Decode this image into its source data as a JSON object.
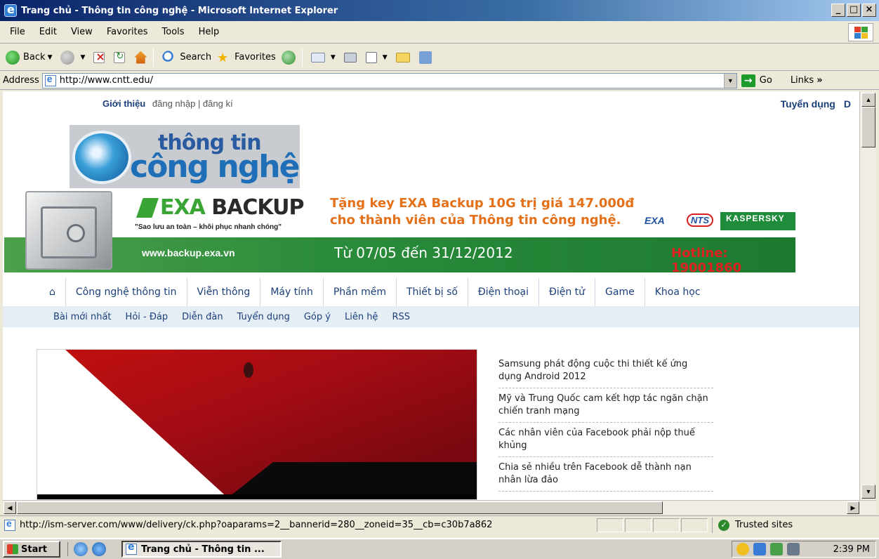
{
  "window": {
    "title": "Trang chủ - Thông tin công nghệ - Microsoft Internet Explorer",
    "min_label": "_",
    "max_label": "□",
    "close_label": "×"
  },
  "menubar": {
    "items": [
      "File",
      "Edit",
      "View",
      "Favorites",
      "Tools",
      "Help"
    ]
  },
  "toolbar": {
    "back_label": "Back",
    "search_label": "Search",
    "favorites_label": "Favorites"
  },
  "addressbar": {
    "label": "Address",
    "url": "http://www.cntt.edu/",
    "go_label": "Go",
    "links_label": "Links"
  },
  "site": {
    "top_links": {
      "intro": "Giới thiệu",
      "login": "đăng nhập | đăng kí"
    },
    "top_right": {
      "recruit": "Tuyển dụng",
      "cut": "D"
    },
    "logo": {
      "line1": "thông tin",
      "line2": "công nghệ"
    },
    "banner": {
      "brand_prefix": "EXA",
      "brand_suffix": " BACKUP",
      "slogan": "\"Sao lưu an toàn – khôi phục nhanh chóng\"",
      "promo_line1": "Tặng key EXA Backup 10G trị giá 147.000đ",
      "promo_line2": "cho thành viên của Thông tin công nghệ.",
      "site": "www.backup.exa.vn",
      "dates": "Từ 07/05 đến 31/12/2012",
      "hotline": "Hotline: 19001860",
      "exa_small": "EXA",
      "nts": "NTS",
      "kaspersky": "KASPERSKY"
    },
    "mainnav": [
      "⌂",
      "Công nghệ thông tin",
      "Viễn thông",
      "Máy tính",
      "Phần mềm",
      "Thiết bị số",
      "Điện thoại",
      "Điện tử",
      "Game",
      "Khoa học"
    ],
    "subnav": [
      "Bài mới nhất",
      "Hỏi - Đáp",
      "Diễn đàn",
      "Tuyển dụng",
      "Góp ý",
      "Liên hệ",
      "RSS"
    ],
    "news": [
      "Samsung phát động cuộc thi thiết kế ứng dụng Android 2012",
      "Mỹ và Trung Quốc cam kết hợp tác ngăn chặn chiến tranh mạng",
      "Các nhân viên của Facebook phải nộp thuế khủng",
      "Chia sẻ nhiều trên Facebook dễ thành nạn nhân lừa đảo"
    ]
  },
  "statusbar": {
    "text": "http://ism-server.com/www/delivery/ck.php?oaparams=2__bannerid=280__zoneid=35__cb=c30b7a862",
    "zone": "Trusted sites"
  },
  "taskbar": {
    "start_label": "Start",
    "task_label": "Trang chủ - Thông tin ...",
    "clock": "2:39 PM"
  }
}
